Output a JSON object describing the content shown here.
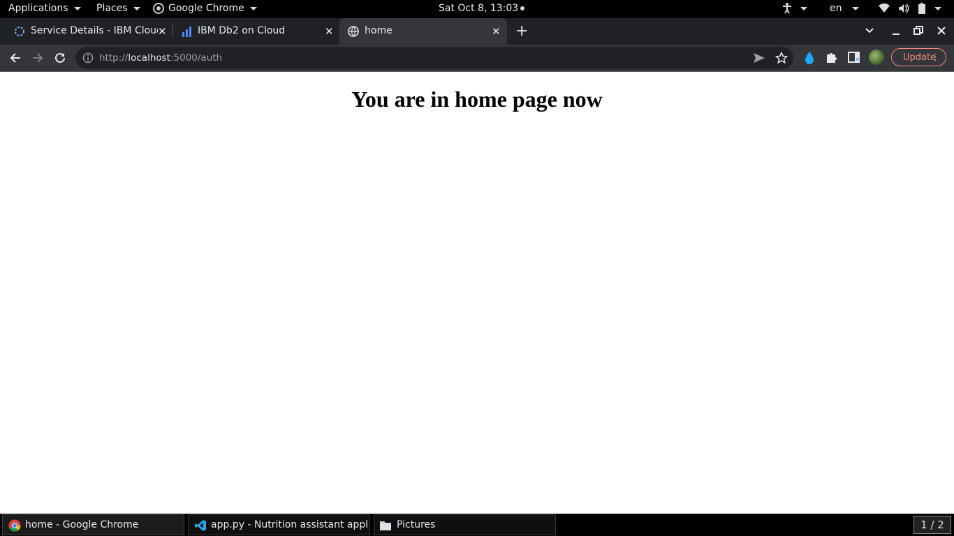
{
  "topbar": {
    "applications": "Applications",
    "places": "Places",
    "active_app": "Google Chrome",
    "clock": "Sat Oct  8, 13:03",
    "language": "en"
  },
  "browser": {
    "tabs": [
      {
        "title": "Service Details - IBM Cloud",
        "icon": "ibm-cloud-icon",
        "active": false
      },
      {
        "title": "IBM Db2 on Cloud",
        "icon": "db2-chart-icon",
        "active": false
      },
      {
        "title": "home",
        "icon": "globe-icon",
        "active": true
      }
    ],
    "new_tab": "+",
    "url": {
      "scheme": "http://",
      "host": "localhost",
      "rest": ":5000/auth"
    },
    "update_label": "Update"
  },
  "page": {
    "heading": "You are in home page now"
  },
  "taskbar": {
    "items": [
      {
        "label": "home - Google Chrome",
        "icon": "chrome-icon",
        "active": true
      },
      {
        "label": "app.py - Nutrition assistant applic...",
        "icon": "vscode-icon",
        "active": false
      },
      {
        "label": "Pictures",
        "icon": "folder-icon",
        "active": false
      }
    ],
    "workspace": "1 / 2"
  },
  "colors": {
    "tabstrip": "#202124",
    "toolbar": "#35363a",
    "update": "#f28b82",
    "accent_drop": "#1ea7fd"
  }
}
